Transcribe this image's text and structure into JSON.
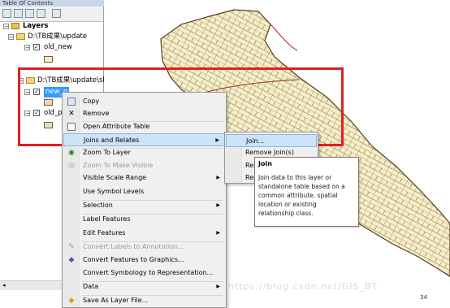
{
  "toc": {
    "title": "Table Of Contents",
    "layers_label": "Layers",
    "group1_path": "D:\\TB成果\\update",
    "group1_layer": "old_new",
    "group2_path": "D:\\TB成果\\update\\sh",
    "group2_layer_selected": "new_n",
    "group2_layer2": "old_p",
    "layer1_color": "#f5efc8",
    "layer2_color": "#f0d5b0",
    "layer3_color": "#cfe8d0"
  },
  "context_menu": {
    "copy": "Copy",
    "remove": "Remove",
    "open_attribute_table": "Open Attribute Table",
    "joins_and_relates": "Joins and Relates",
    "zoom_to_layer": "Zoom To Layer",
    "zoom_to_make_visible": "Zoom To Make Visible",
    "visible_scale_range": "Visible Scale Range",
    "use_symbol_levels": "Use Symbol Levels",
    "selection": "Selection",
    "label_features": "Label Features",
    "edit_features": "Edit Features",
    "convert_labels": "Convert Labels to Annotation...",
    "convert_features": "Convert Features to Graphics...",
    "convert_symbology": "Convert Symbology to Representation...",
    "data": "Data",
    "save_as_layer_file": "Save As Layer File..."
  },
  "submenu": {
    "join": "Join...",
    "remove_joins": "Remove Join(s)",
    "relate": "Rela",
    "remove_relates": "Rem"
  },
  "tooltip": {
    "title": "Join",
    "body": "Join data to this layer or standalone table based on a common attribute, spatial location or existing relationship class."
  },
  "watermark": "https://blog.csdn.net/GIS_BT",
  "status_text": "34",
  "colors": {
    "highlight_red": "#e02020",
    "map_fill": "#f5efc8",
    "map_line": "#6b4a2a",
    "menu_highlight": "#cde3f7"
  }
}
